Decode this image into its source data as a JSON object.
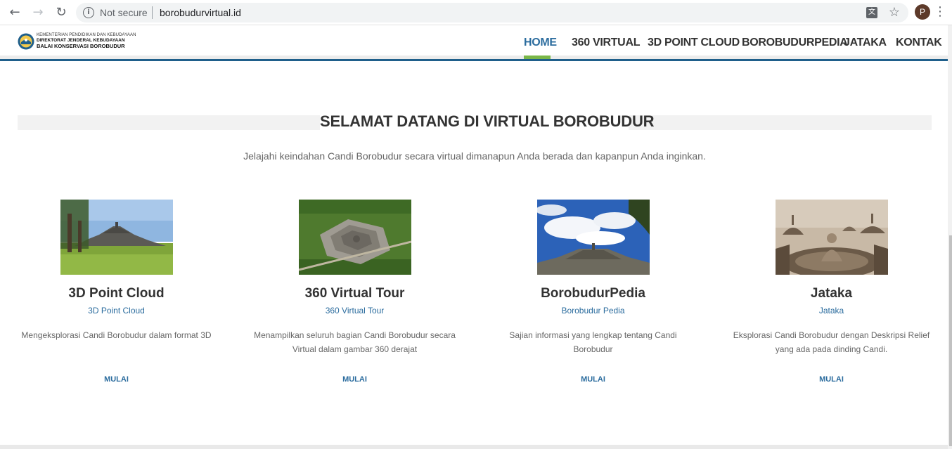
{
  "browser": {
    "security_label": "Not secure",
    "url": "borobudurvirtual.id",
    "profile_initial": "P"
  },
  "site": {
    "logo_lines": [
      "KEMENTERIAN PENDIDIKAN DAN KEBUDAYAAN",
      "DIREKTORAT JENDERAL KEBUDAYAAN",
      "BALAI KONSERVASI BOROBUDUR"
    ],
    "menu": [
      "HOME",
      "360 VIRTUAL",
      "3D POINT CLOUD",
      "BOROBUDURPEDIA",
      "JATAKA",
      "KONTAK"
    ],
    "active_menu": "HOME",
    "accent": "#2b6c9e",
    "active_underline": "#7ab648"
  },
  "main": {
    "title": "SELAMAT DATANG DI VIRTUAL BOROBUDUR",
    "subtitle": "Jelajahi keindahan Candi Borobudur secara virtual dimanapun Anda berada dan kapanpun Anda inginkan.",
    "cards": [
      {
        "title": "3D Point Cloud",
        "subtitle": "3D Point Cloud",
        "description": "Mengeksplorasi Candi Borobudur dalam format 3D",
        "button": "MULAI"
      },
      {
        "title": "360 Virtual Tour",
        "subtitle": "360 Virtual Tour",
        "description": "Menampilkan seluruh bagian Candi Borobudur secara Virtual dalam gambar 360 derajat",
        "button": "MULAI"
      },
      {
        "title": "BorobudurPedia",
        "subtitle": "Borobudur Pedia",
        "description": "Sajian informasi yang lengkap tentang Candi Borobudur",
        "button": "MULAI"
      },
      {
        "title": "Jataka",
        "subtitle": "Jataka",
        "description": "Eksplorasi Candi Borobudur dengan Deskripsi Relief yang ada pada dinding Candi.",
        "button": "MULAI"
      }
    ]
  }
}
